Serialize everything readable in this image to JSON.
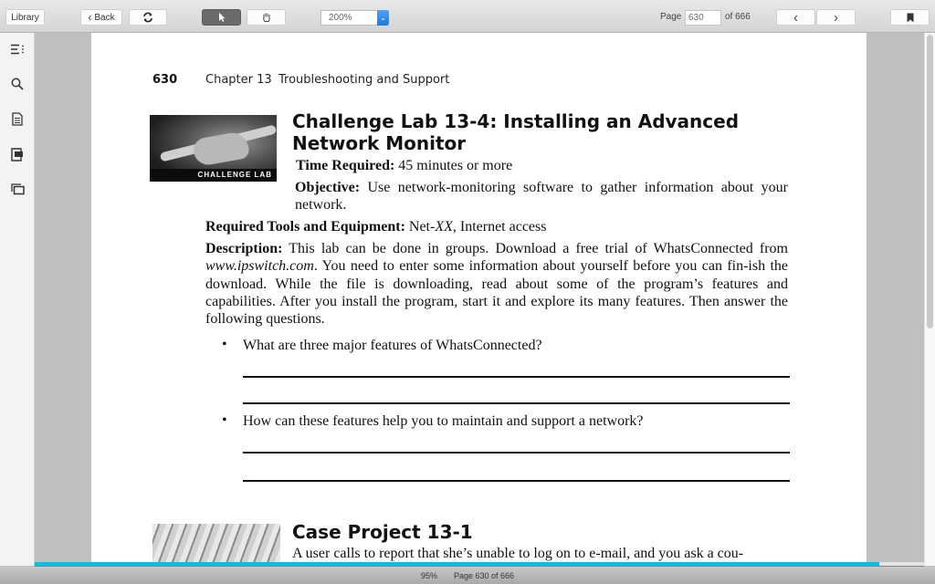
{
  "toolbar": {
    "library_label": "Library",
    "back_label": "Back",
    "zoom_value": "200%",
    "page_label": "Page",
    "page_value": "630",
    "page_total": "of 666",
    "icons": {
      "back": "chevron-left-icon",
      "refresh": "refresh-icon",
      "select": "arrow-cursor-icon",
      "pan": "hand-icon",
      "prev": "chevron-left-icon",
      "next": "chevron-right-icon",
      "bookmark": "bookmark-icon"
    }
  },
  "sidebar": {
    "items": [
      {
        "name": "table-of-contents",
        "icon": "list-icon"
      },
      {
        "name": "search",
        "icon": "search-icon"
      },
      {
        "name": "notes",
        "icon": "document-icon"
      },
      {
        "name": "flashcards",
        "icon": "card-icon"
      },
      {
        "name": "pages",
        "icon": "pages-icon"
      }
    ]
  },
  "page": {
    "header": {
      "page_number": "630",
      "chapter": "Chapter 13",
      "chapter_title": "Troubleshooting and Support"
    },
    "challenge_lab": {
      "image_caption": "CHALLENGE LAB",
      "title_line1": "Challenge Lab 13-4: Installing an Advanced",
      "title_line2": "Network Monitor",
      "time_label": "Time Required:",
      "time_value": "45 minutes or more",
      "objective_label": "Objective:",
      "objective_text": "Use network-monitoring software to gather information about your network.",
      "tools_label": "Required Tools and Equipment:",
      "tools_value_pre": "Net-",
      "tools_value_italic": "XX",
      "tools_value_post": ", Internet access",
      "description_label": "Description:",
      "description_text_1": "This lab can be done in groups. Download a free trial of WhatsConnected from",
      "description_url": "www.ipswitch.com",
      "description_text_2": ". You need to enter some information about yourself before you can fin-ish the download. While the file is downloading, read about some of the program’s features and capabilities. After you install the program, start it and explore its many features. Then answer the following questions.",
      "questions": [
        "What are three major features of WhatsConnected?",
        "How can these features help you to maintain and support a network?"
      ],
      "bullet": "•"
    },
    "case_project": {
      "title": "Case Project 13-1",
      "text": "A user calls to report that she’s unable to log on to e-mail, and you ask a cou-"
    }
  },
  "status": {
    "progress_percent_label": "95%",
    "progress_fraction": 0.95,
    "page_status": "Page 630 of 666"
  },
  "colors": {
    "progress": "#00bfe6",
    "zoom_dropdown_accent": "#1e7ae0",
    "active_tool": "#6b6b6b"
  }
}
